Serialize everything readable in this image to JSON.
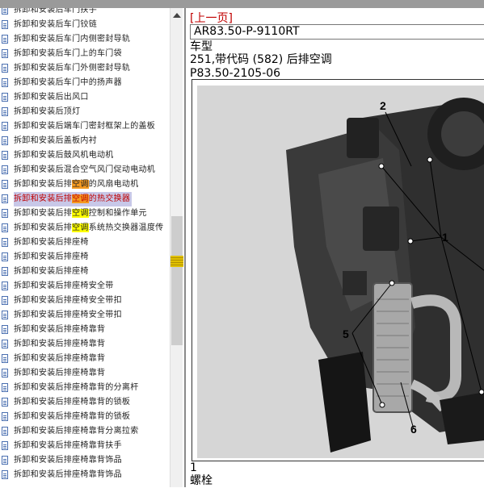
{
  "tree": {
    "items": [
      {
        "pre": "拆卸和安装后车门扶手",
        "hl": "",
        "post": ""
      },
      {
        "pre": "拆卸和安装后车门铰链",
        "hl": "",
        "post": ""
      },
      {
        "pre": "拆卸和安装后车门内侧密封导轨",
        "hl": "",
        "post": ""
      },
      {
        "pre": "拆卸和安装后车门上的车门袋",
        "hl": "",
        "post": ""
      },
      {
        "pre": "拆卸和安装后车门外侧密封导轨",
        "hl": "",
        "post": ""
      },
      {
        "pre": "拆卸和安装后车门中的扬声器",
        "hl": "",
        "post": ""
      },
      {
        "pre": "拆卸和安装后出风口",
        "hl": "",
        "post": ""
      },
      {
        "pre": "拆卸和安装后顶灯",
        "hl": "",
        "post": ""
      },
      {
        "pre": "拆卸和安装后端车门密封框架上的盖板",
        "hl": "",
        "post": ""
      },
      {
        "pre": "拆卸和安装后盖板内衬",
        "hl": "",
        "post": ""
      },
      {
        "pre": "拆卸和安装后鼓风机电动机",
        "hl": "",
        "post": ""
      },
      {
        "pre": "拆卸和安装后混合空气风门促动电动机",
        "hl": "",
        "post": ""
      },
      {
        "pre": "拆卸和安装后排",
        "hl": "空调",
        "post": "的风扇电动机"
      },
      {
        "pre": "拆卸和安装后排",
        "hl": "空调",
        "post": "的热交换器",
        "selected": true
      },
      {
        "pre": "拆卸和安装后排",
        "hl": "空调",
        "post": "控制和操作单元"
      },
      {
        "pre": "拆卸和安装后排",
        "hl": "空调",
        "post": "系统热交换器温度传"
      },
      {
        "pre": "拆卸和安装后排座椅",
        "hl": "",
        "post": ""
      },
      {
        "pre": "拆卸和安装后排座椅",
        "hl": "",
        "post": ""
      },
      {
        "pre": "拆卸和安装后排座椅",
        "hl": "",
        "post": ""
      },
      {
        "pre": "拆卸和安装后排座椅安全带",
        "hl": "",
        "post": ""
      },
      {
        "pre": "拆卸和安装后排座椅安全带扣",
        "hl": "",
        "post": ""
      },
      {
        "pre": "拆卸和安装后排座椅安全带扣",
        "hl": "",
        "post": ""
      },
      {
        "pre": "拆卸和安装后排座椅靠背",
        "hl": "",
        "post": ""
      },
      {
        "pre": "拆卸和安装后排座椅靠背",
        "hl": "",
        "post": ""
      },
      {
        "pre": "拆卸和安装后排座椅靠背",
        "hl": "",
        "post": ""
      },
      {
        "pre": "拆卸和安装后排座椅靠背",
        "hl": "",
        "post": ""
      },
      {
        "pre": "拆卸和安装后排座椅靠背的分离杆",
        "hl": "",
        "post": ""
      },
      {
        "pre": "拆卸和安装后排座椅靠背的锁板",
        "hl": "",
        "post": ""
      },
      {
        "pre": "拆卸和安装后排座椅靠背的锁板",
        "hl": "",
        "post": ""
      },
      {
        "pre": "拆卸和安装后排座椅靠背分离拉索",
        "hl": "",
        "post": ""
      },
      {
        "pre": "拆卸和安装后排座椅靠背扶手",
        "hl": "",
        "post": ""
      },
      {
        "pre": "拆卸和安装后排座椅靠背饰品",
        "hl": "",
        "post": ""
      },
      {
        "pre": "拆卸和安装后排座椅靠背饰品",
        "hl": "",
        "post": ""
      }
    ]
  },
  "content": {
    "prev_link": "[上一页]",
    "doc_code": "AR83.50-P-9110RT",
    "vehicle_label": "车型",
    "vehicle_value": "251,带代码 (582) 后排空调",
    "procedure_code": "P83.50-2105-06",
    "footer_number": "1",
    "footer_label": "螺栓"
  },
  "figure": {
    "callouts": [
      "2",
      "1",
      "5",
      "6"
    ]
  },
  "colors": {
    "link_red": "#c00000",
    "highlight_orange": "#f59a20",
    "highlight_yellow": "#ffff00",
    "selected_bg": "#c8c8e8"
  }
}
